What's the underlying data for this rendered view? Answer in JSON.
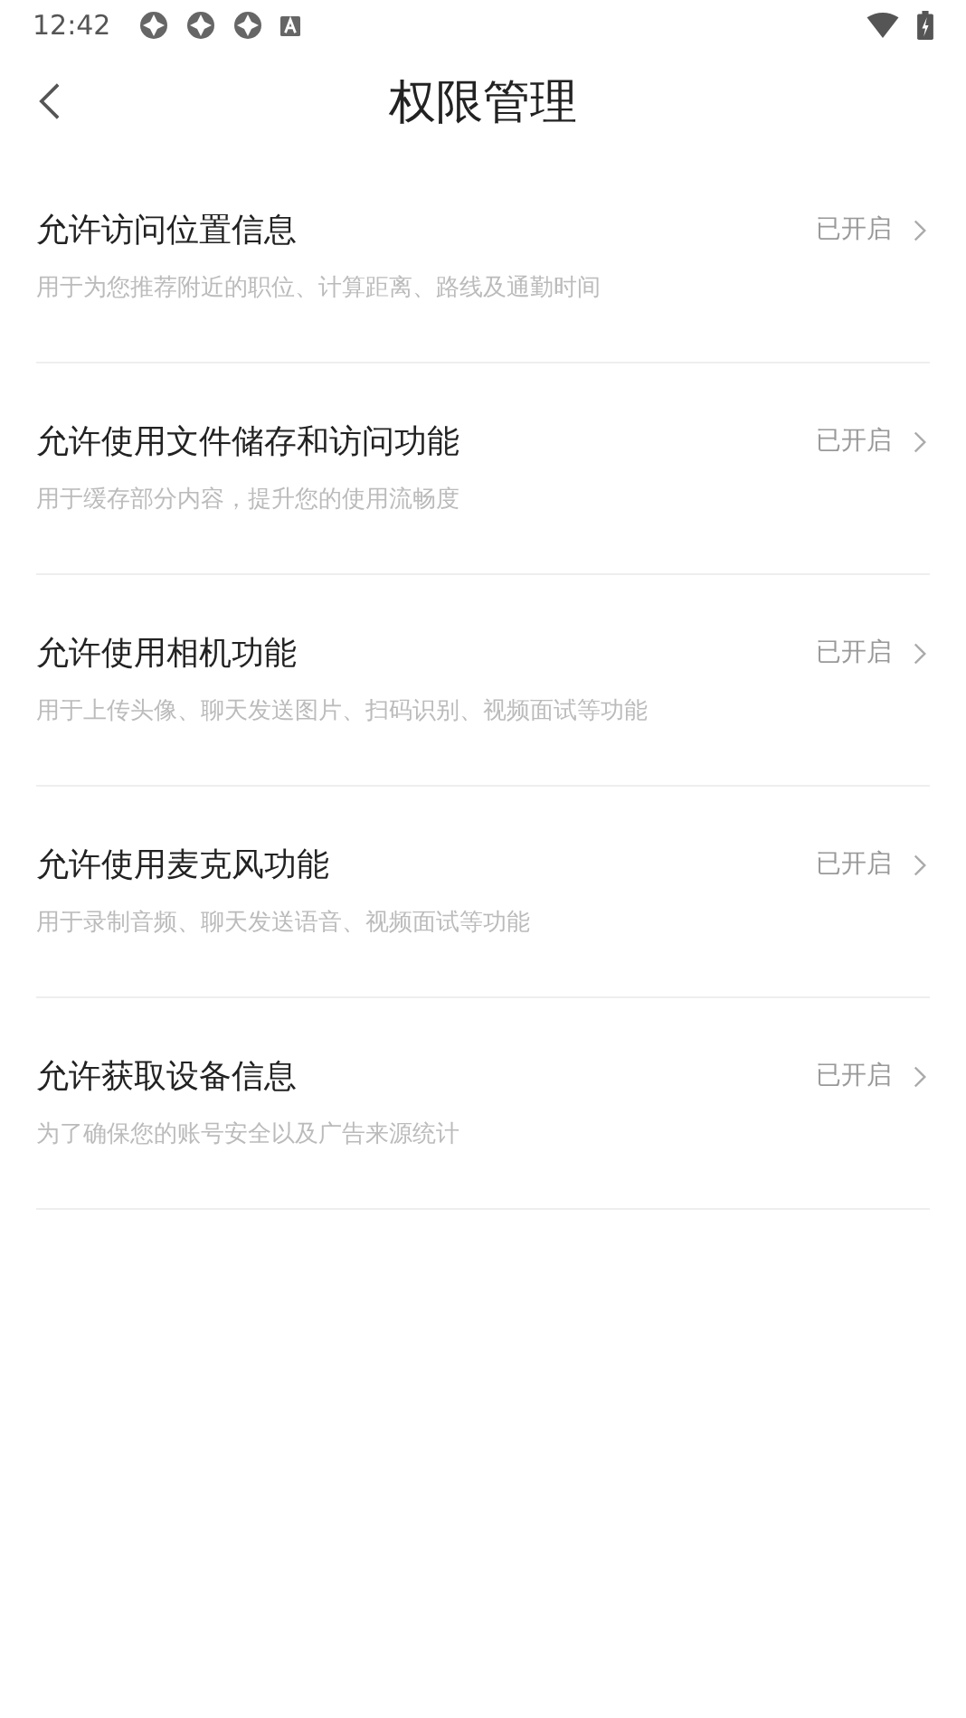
{
  "status_bar": {
    "time": "12:42"
  },
  "header": {
    "title": "权限管理"
  },
  "permissions": [
    {
      "title": "允许访问位置信息",
      "description": "用于为您推荐附近的职位、计算距离、路线及通勤时间",
      "status": "已开启"
    },
    {
      "title": "允许使用文件储存和访问功能",
      "description": "用于缓存部分内容，提升您的使用流畅度",
      "status": "已开启"
    },
    {
      "title": "允许使用相机功能",
      "description": "用于上传头像、聊天发送图片、扫码识别、视频面试等功能",
      "status": "已开启"
    },
    {
      "title": "允许使用麦克风功能",
      "description": "用于录制音频、聊天发送语音、视频面试等功能",
      "status": "已开启"
    },
    {
      "title": "允许获取设备信息",
      "description": "为了确保您的账号安全以及广告来源统计",
      "status": "已开启"
    }
  ]
}
